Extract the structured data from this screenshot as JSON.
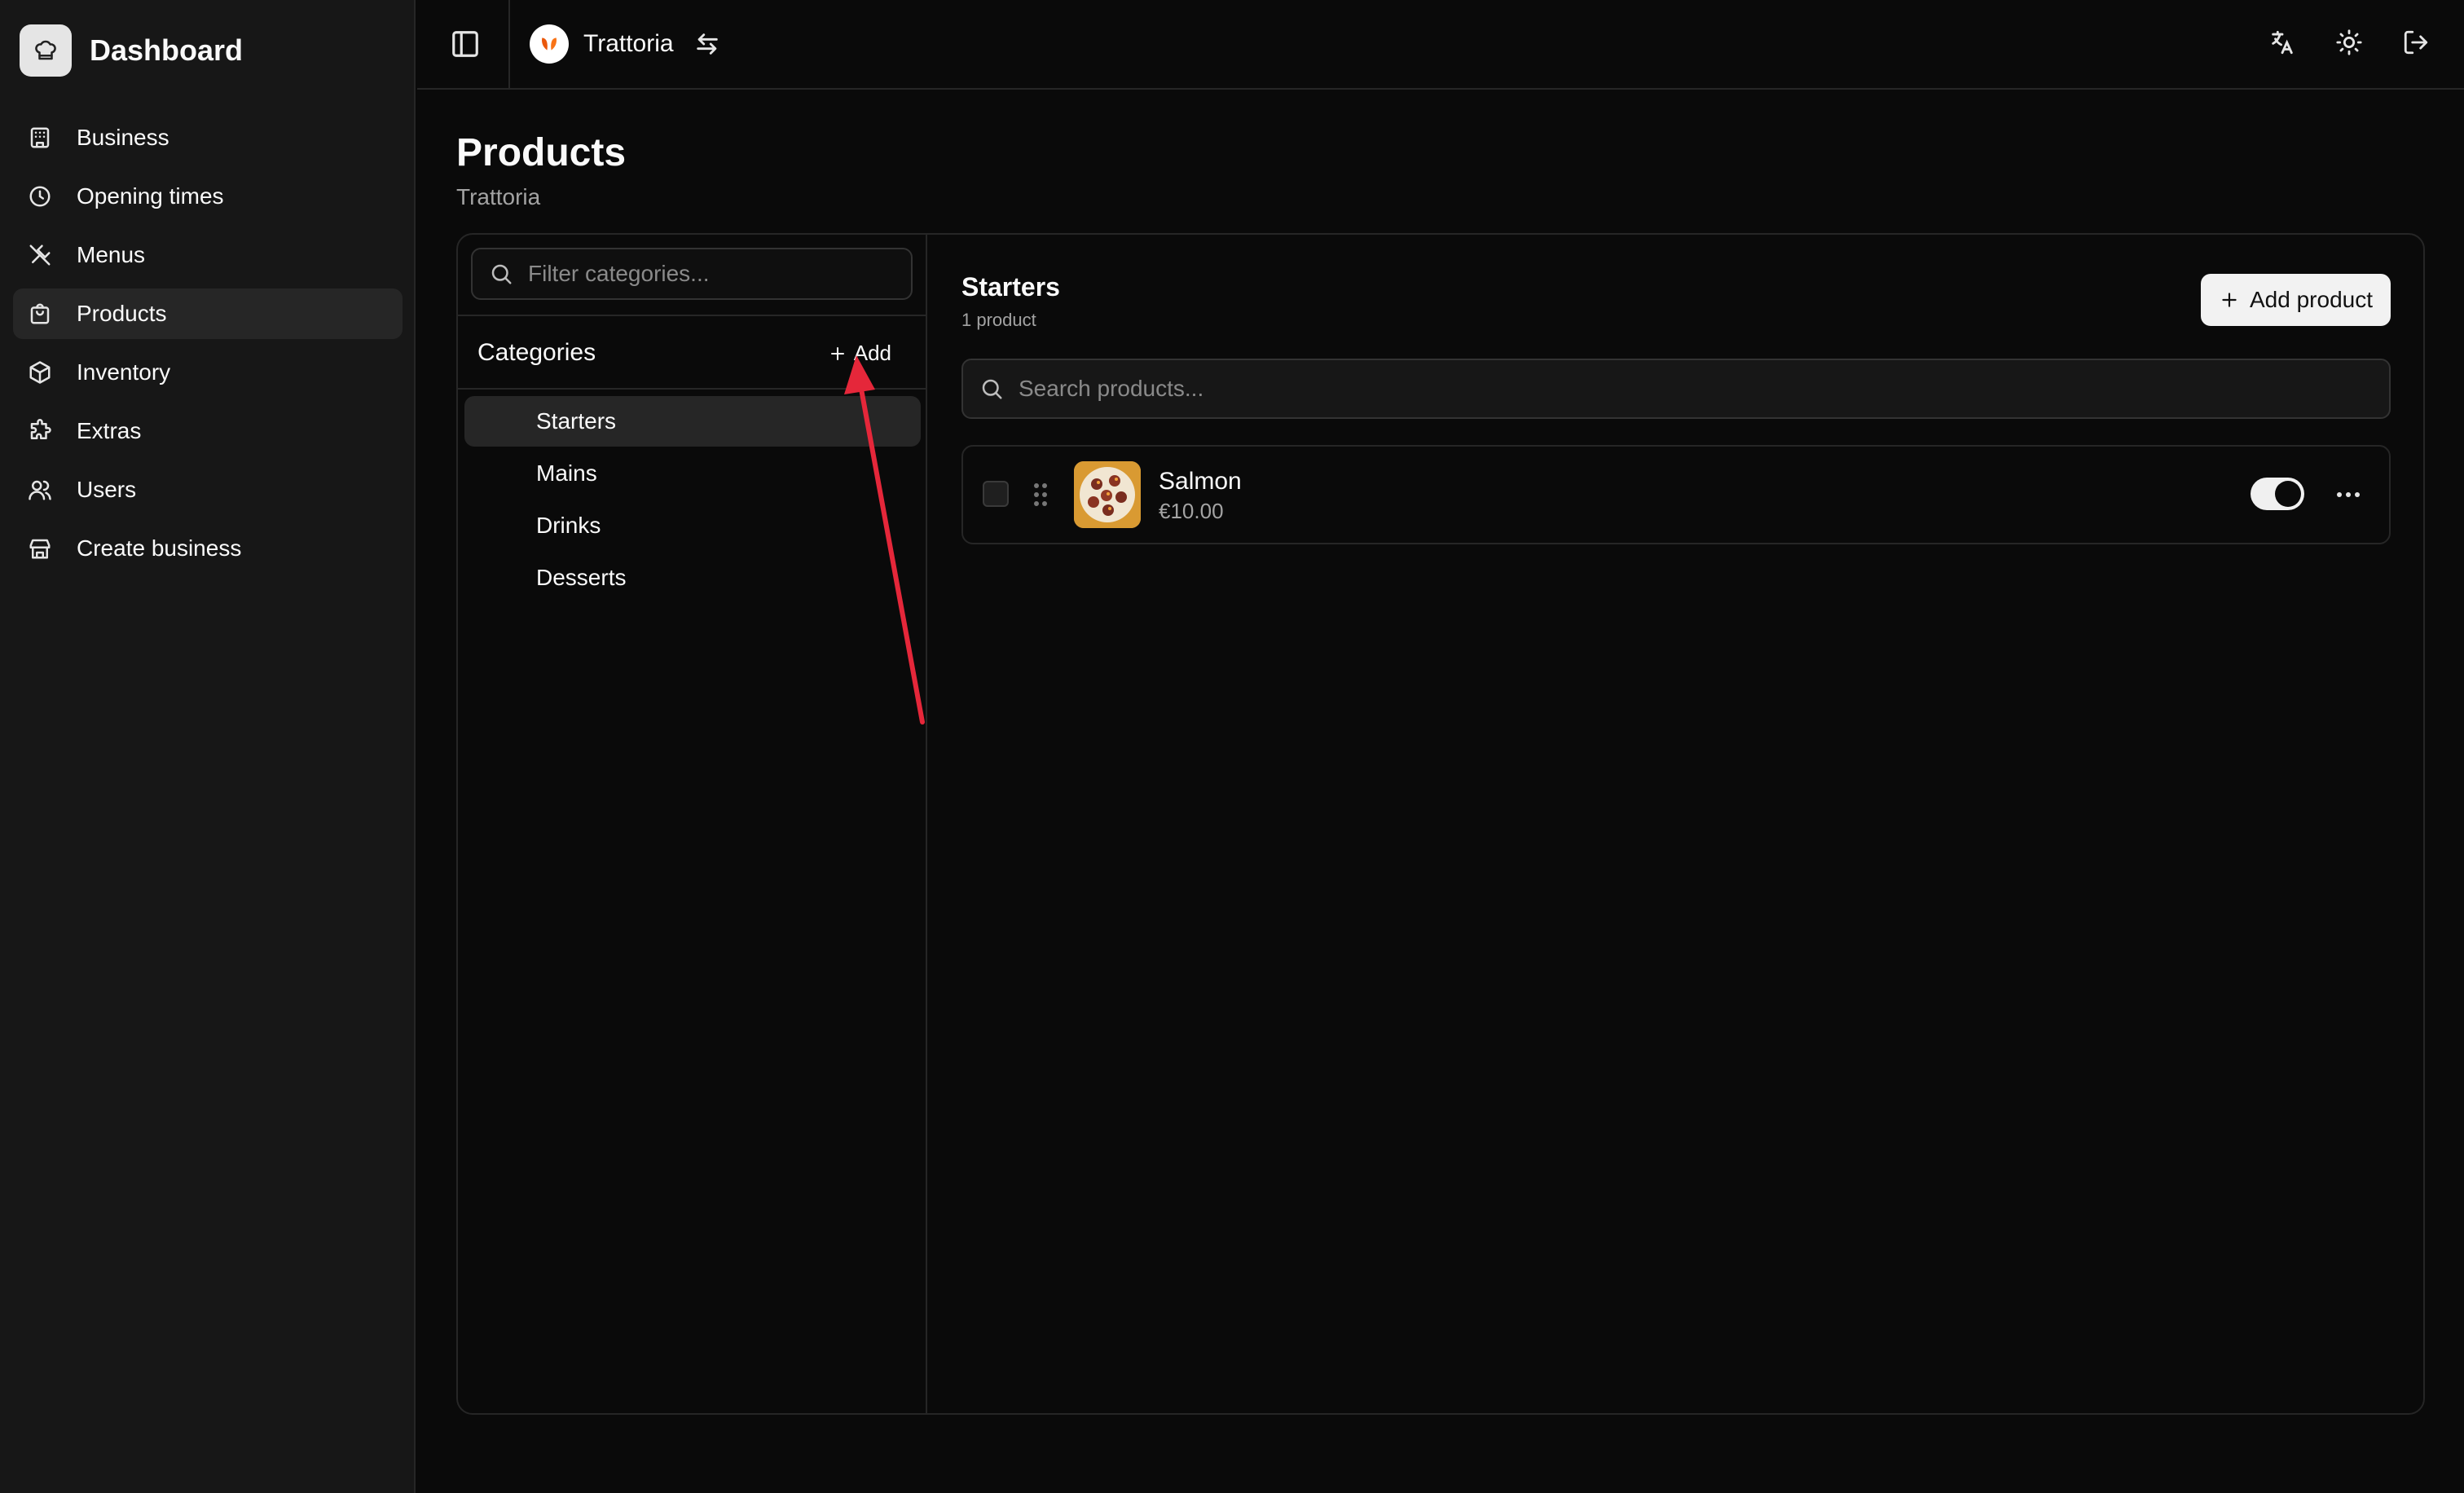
{
  "app": {
    "title": "Dashboard"
  },
  "sidebar": {
    "items": [
      {
        "label": "Business",
        "icon": "building-icon"
      },
      {
        "label": "Opening times",
        "icon": "clock-icon"
      },
      {
        "label": "Menus",
        "icon": "utensils-icon"
      },
      {
        "label": "Products",
        "icon": "shopping-bag-icon",
        "active": true
      },
      {
        "label": "Inventory",
        "icon": "package-icon"
      },
      {
        "label": "Extras",
        "icon": "puzzle-icon"
      },
      {
        "label": "Users",
        "icon": "users-icon"
      },
      {
        "label": "Create business",
        "icon": "store-icon"
      }
    ]
  },
  "topbar": {
    "business_name": "Trattoria",
    "icons": [
      "sidebar-toggle-icon",
      "switch-arrows-icon",
      "language-icon",
      "sun-icon",
      "logout-icon"
    ]
  },
  "page": {
    "title": "Products",
    "subtitle": "Trattoria"
  },
  "categories": {
    "filter_placeholder": "Filter categories...",
    "header": "Categories",
    "add_label": "Add",
    "items": [
      "Starters",
      "Mains",
      "Drinks",
      "Desserts"
    ],
    "selected": "Starters"
  },
  "products_panel": {
    "title": "Starters",
    "count_text": "1 product",
    "add_button": "Add product",
    "search_placeholder": "Search products...",
    "items": [
      {
        "name": "Salmon",
        "price": "€10.00",
        "enabled": true
      }
    ]
  },
  "colors": {
    "background": "#0a0a0a",
    "sidebar": "#171717",
    "border": "#262626",
    "annotation_arrow": "#e5273a",
    "brand_accent": "#ea580c"
  }
}
